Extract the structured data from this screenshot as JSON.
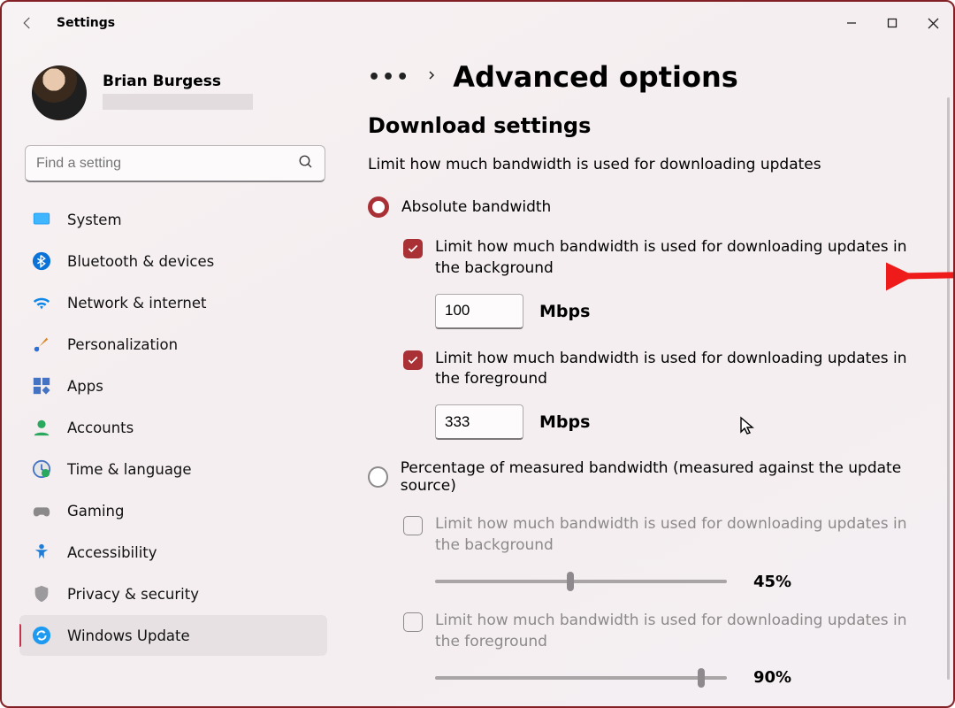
{
  "app": {
    "title": "Settings"
  },
  "profile": {
    "name": "Brian Burgess"
  },
  "search": {
    "placeholder": "Find a setting"
  },
  "nav": {
    "items": [
      {
        "id": "system",
        "label": "System"
      },
      {
        "id": "bluetooth",
        "label": "Bluetooth & devices"
      },
      {
        "id": "network",
        "label": "Network & internet"
      },
      {
        "id": "personalization",
        "label": "Personalization"
      },
      {
        "id": "apps",
        "label": "Apps"
      },
      {
        "id": "accounts",
        "label": "Accounts"
      },
      {
        "id": "time",
        "label": "Time & language"
      },
      {
        "id": "gaming",
        "label": "Gaming"
      },
      {
        "id": "accessibility",
        "label": "Accessibility"
      },
      {
        "id": "privacy",
        "label": "Privacy & security"
      },
      {
        "id": "update",
        "label": "Windows Update"
      }
    ],
    "selected": "update"
  },
  "breadcrumb": {
    "current": "Advanced options"
  },
  "download": {
    "section_title": "Download settings",
    "section_sub": "Limit how much bandwidth is used for downloading updates",
    "absolute_label": "Absolute bandwidth",
    "percentage_label": "Percentage of measured bandwidth (measured against the update source)",
    "bg_label": "Limit how much bandwidth is used for downloading updates in the background",
    "fg_label": "Limit how much bandwidth is used for downloading updates in the foreground",
    "bg_value": "100",
    "fg_value": "333",
    "unit": "Mbps",
    "pct_bg_label": "Limit how much bandwidth is used for downloading updates in the background",
    "pct_fg_label": "Limit how much bandwidth is used for downloading updates in the foreground",
    "pct_bg_value": "45%",
    "pct_fg_value": "90%",
    "pct_bg_pos": 45,
    "pct_fg_pos": 90
  },
  "colors": {
    "accent": "#a93135",
    "arrow": "#ef1a1a"
  }
}
